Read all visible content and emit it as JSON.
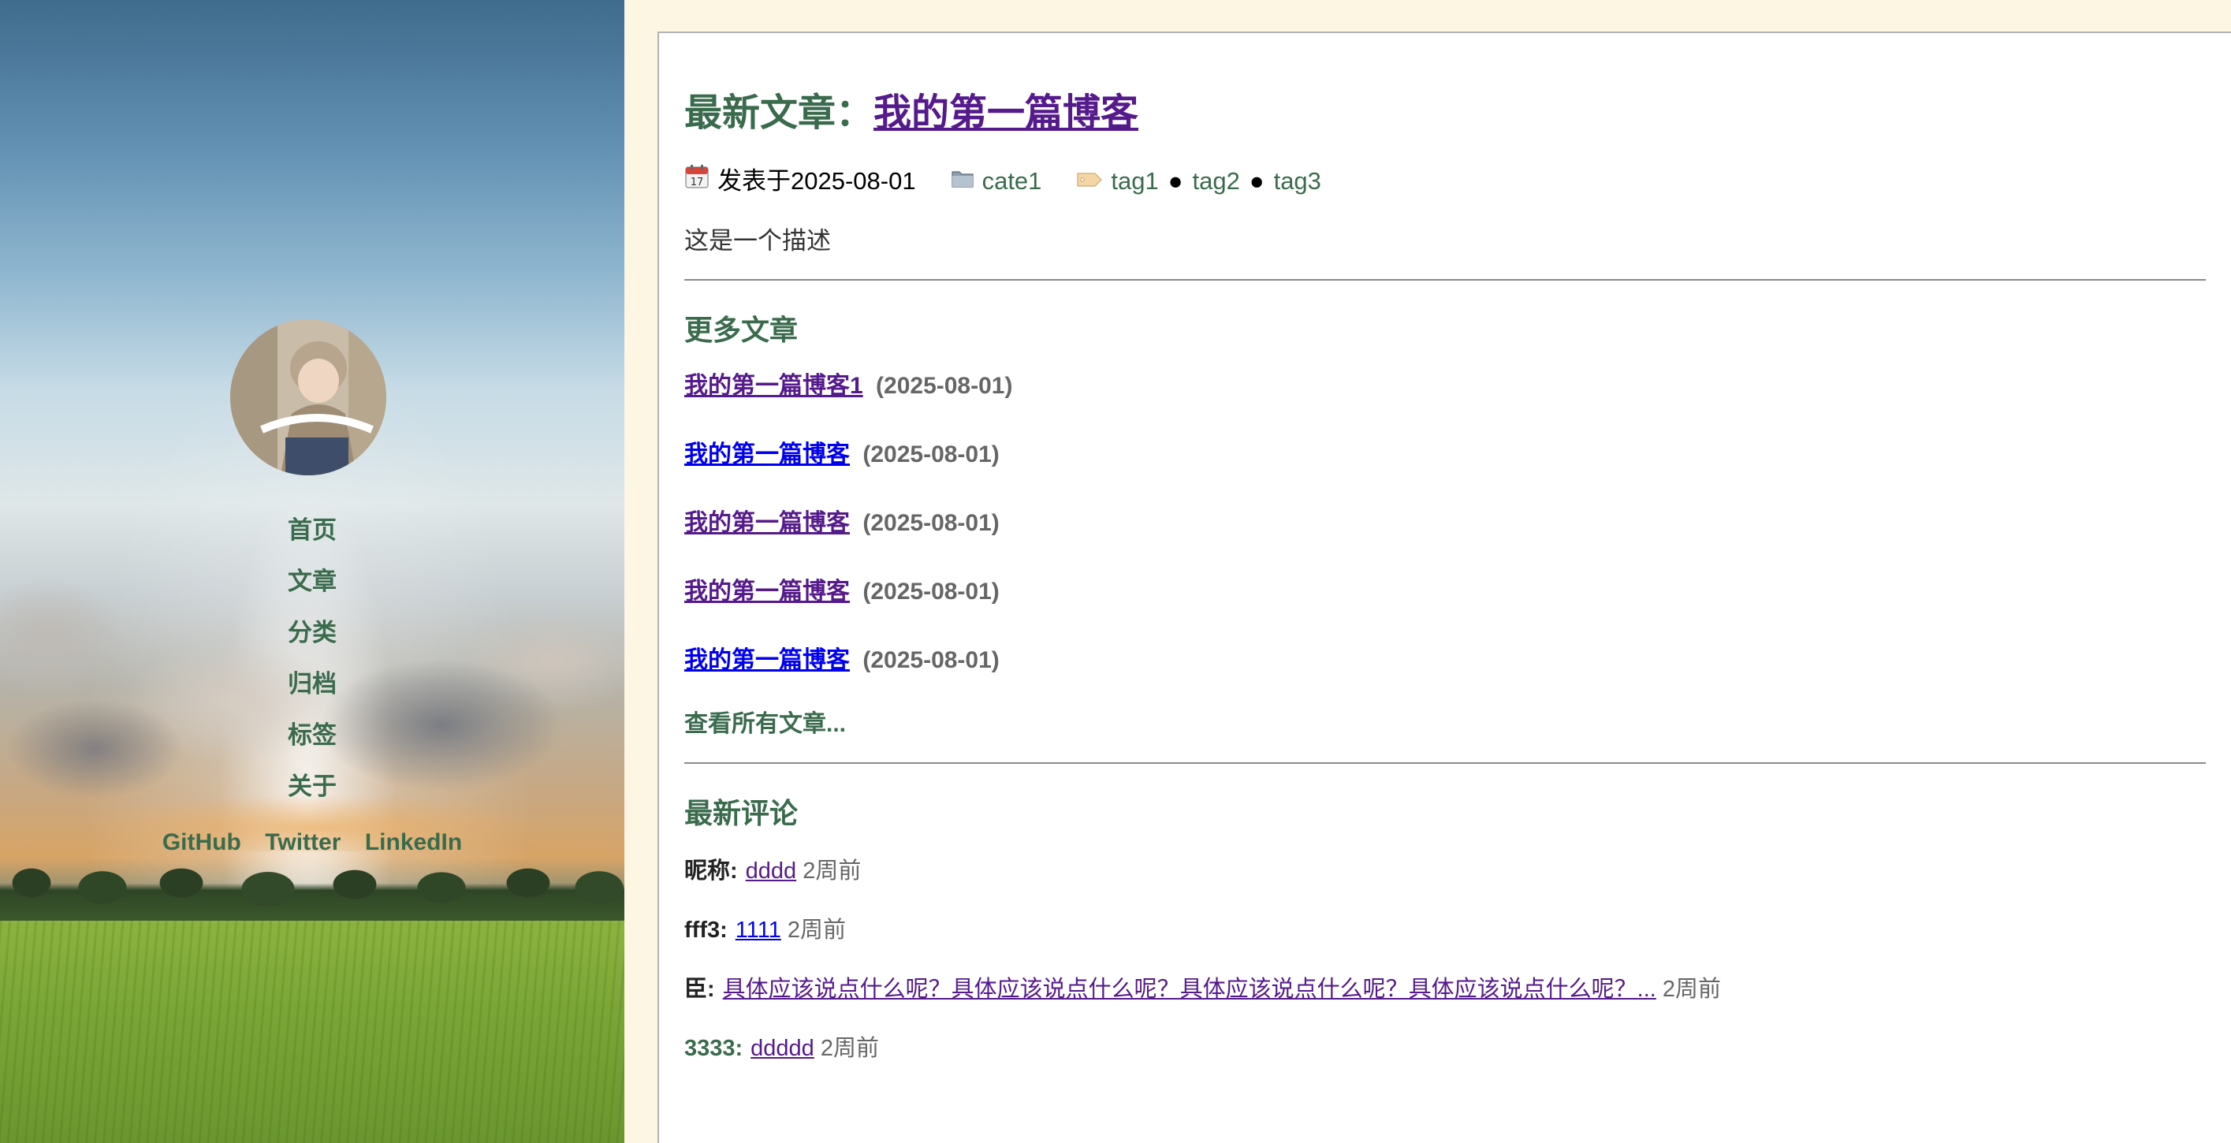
{
  "sidebar": {
    "nav": [
      "首页",
      "文章",
      "分类",
      "归档",
      "标签",
      "关于"
    ],
    "social": [
      "GitHub",
      "Twitter",
      "LinkedIn"
    ]
  },
  "latest": {
    "label": "最新文章：",
    "title": "我的第一篇博客",
    "published_label": "发表于2025-08-01",
    "category": "cate1",
    "tags": [
      "tag1",
      "tag2",
      "tag3"
    ],
    "tag_separator": "●",
    "description": "这是一个描述"
  },
  "more_posts": {
    "heading": "更多文章",
    "items": [
      {
        "title": "我的第一篇博客1",
        "date": "(2025-08-01)",
        "visited": true
      },
      {
        "title": "我的第一篇博客",
        "date": "(2025-08-01)",
        "visited": false
      },
      {
        "title": "我的第一篇博客",
        "date": "(2025-08-01)",
        "visited": true
      },
      {
        "title": "我的第一篇博客",
        "date": "(2025-08-01)",
        "visited": true
      },
      {
        "title": "我的第一篇博客",
        "date": "(2025-08-01)",
        "visited": false
      }
    ],
    "view_all": "查看所有文章..."
  },
  "comments": {
    "heading": "最新评论",
    "items": [
      {
        "nick": "昵称:",
        "text": "dddd",
        "ago": "2周前"
      },
      {
        "nick": "fff3:",
        "text": "1111",
        "ago": "2周前"
      },
      {
        "nick": "臣:",
        "text": "具体应该说点什么呢？具体应该说点什么呢？具体应该说点什么呢？具体应该说点什么呢？...",
        "ago": "2周前"
      },
      {
        "nick": "3333:",
        "text": "ddddd",
        "ago": "2周前"
      }
    ]
  },
  "colors": {
    "accent_green": "#3a6b4c",
    "visited_link": "#551a8b",
    "unvisited_link": "#0000ee",
    "page_bg": "#fcf6e3"
  },
  "icons": {
    "calendar": "calendar-icon",
    "folder": "folder-icon",
    "tag": "tag-icon"
  }
}
